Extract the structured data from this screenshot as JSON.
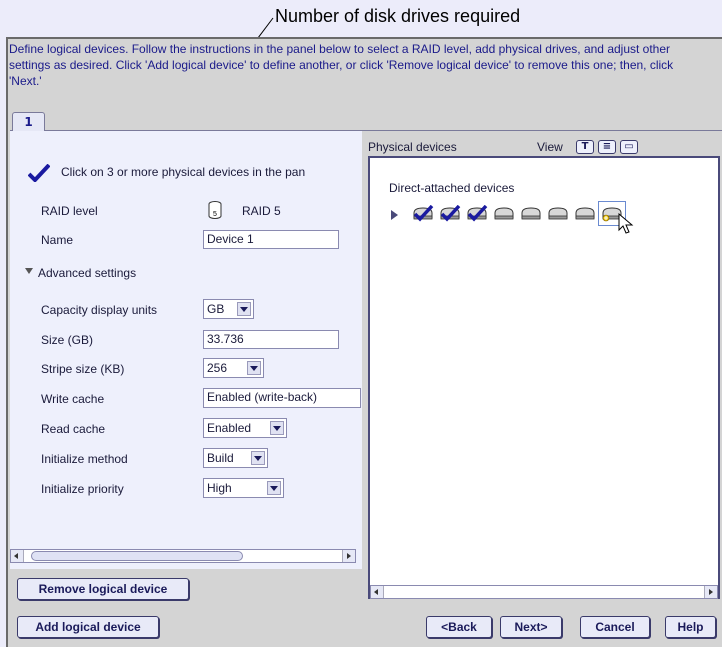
{
  "callout": {
    "text": "Number of disk drives required"
  },
  "instructions": "Define logical devices.  Follow the instructions in the panel below to select a RAID level, add physical drives, and adjust other settings as desired.  Click 'Add logical device' to define another, or click 'Remove logical device' to remove this one; then, click 'Next.'",
  "tabs": [
    {
      "label": "1"
    }
  ],
  "left": {
    "hint": "Click on 3 or more physical devices in the pan",
    "raid_label": "RAID level",
    "raid_value": "RAID 5",
    "raid_icon": "disk-5-icon",
    "name_label": "Name",
    "name_value": "Device 1",
    "advanced_label": "Advanced settings",
    "settings": [
      {
        "label": "Capacity display units",
        "value": "GB",
        "type": "combo"
      },
      {
        "label": "Size (GB)",
        "value": "33.736",
        "type": "field"
      },
      {
        "label": "Stripe size (KB)",
        "value": "256",
        "type": "combo"
      },
      {
        "label": "Write cache",
        "value": "Enabled (write-back)",
        "type": "field"
      },
      {
        "label": "Read cache",
        "value": "Enabled",
        "type": "combo"
      },
      {
        "label": "Initialize method",
        "value": "Build",
        "type": "combo"
      },
      {
        "label": "Initialize priority",
        "value": "High",
        "type": "combo"
      }
    ]
  },
  "right": {
    "header_label": "Physical devices",
    "view_label": "View",
    "view_icons": [
      "text-view-icon",
      "list-view-icon",
      "card-view-icon"
    ],
    "group_label": "Direct-attached devices",
    "disks": [
      {
        "selected": true
      },
      {
        "selected": true
      },
      {
        "selected": true
      },
      {
        "selected": false
      },
      {
        "selected": false
      },
      {
        "selected": false
      },
      {
        "selected": false
      },
      {
        "selected": false,
        "hover": true
      }
    ]
  },
  "buttons": {
    "remove": "Remove logical device",
    "add": "Add logical device",
    "back": "<Back",
    "next": "Next>",
    "cancel": "Cancel",
    "help": "Help"
  },
  "colors": {
    "accent": "#1a1a8a",
    "panel": "#eef0fc",
    "window": "#d4d4d4"
  }
}
